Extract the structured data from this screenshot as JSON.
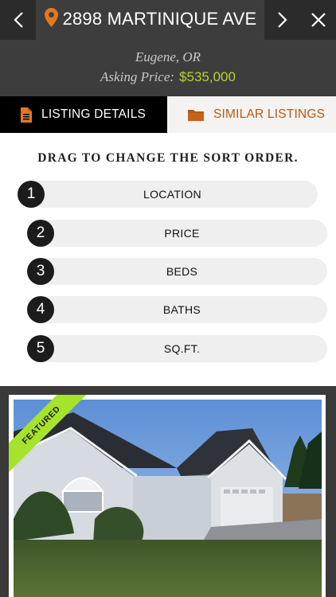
{
  "header": {
    "address": "2898 MARTINIQUE AVE",
    "city": "Eugene, OR",
    "price_label": "Asking Price:",
    "price_value": "$535,000",
    "icons": {
      "back": "chevron-left-icon",
      "next": "chevron-right-icon",
      "close": "close-icon",
      "pin": "map-pin-icon"
    },
    "accent_color": "#e07a1f",
    "price_color": "#b5d334"
  },
  "tabs": [
    {
      "label": "LISTING DETAILS",
      "icon": "document-icon",
      "active": false
    },
    {
      "label": "SIMILAR LISTINGS",
      "icon": "folder-icon",
      "active": true
    }
  ],
  "sort": {
    "title": "DRAG TO CHANGE THE SORT ORDER.",
    "items": [
      {
        "num": "1",
        "label": "LOCATION"
      },
      {
        "num": "2",
        "label": "PRICE"
      },
      {
        "num": "3",
        "label": "BEDS"
      },
      {
        "num": "4",
        "label": "BATHS"
      },
      {
        "num": "5",
        "label": "SQ.FT."
      }
    ]
  },
  "listing": {
    "badge": "FEATURED",
    "badge_color": "#a6e32b"
  }
}
